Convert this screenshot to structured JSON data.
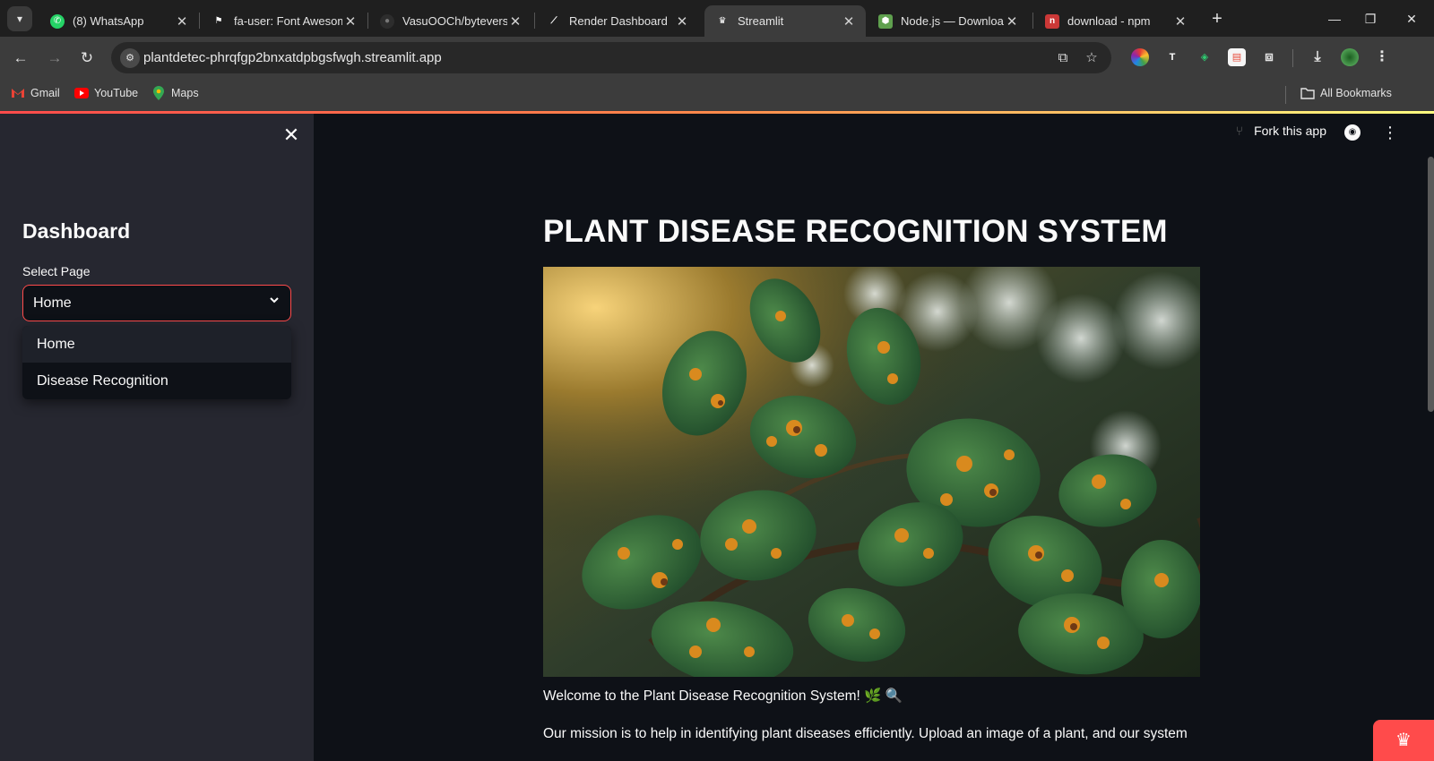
{
  "browser": {
    "tabs": [
      {
        "title": "(8) WhatsApp",
        "icon": "whatsapp-icon"
      },
      {
        "title": "fa-user: Font Awesom",
        "icon": "flag-icon"
      },
      {
        "title": "VasuOOCh/byteverse",
        "icon": "github-icon"
      },
      {
        "title": "Render Dashboard",
        "icon": "render-icon"
      },
      {
        "title": "Streamlit",
        "icon": "streamlit-icon"
      },
      {
        "title": "Node.js — Download",
        "icon": "nodejs-icon"
      },
      {
        "title": "download - npm",
        "icon": "npm-icon"
      }
    ],
    "active_tab": 4,
    "url": "plantdetec-phrqfgp2bnxatdpbgsfwgh.streamlit.app",
    "bookmarks": [
      "Gmail",
      "YouTube",
      "Maps"
    ],
    "all_bookmarks": "All Bookmarks"
  },
  "sidebar": {
    "title": "Dashboard",
    "select_label": "Select Page",
    "selected": "Home",
    "options": [
      "Home",
      "Disease Recognition"
    ]
  },
  "header": {
    "fork_label": "Fork this app"
  },
  "main": {
    "title": "PLANT DISEASE RECOGNITION SYSTEM",
    "welcome": "Welcome to the Plant Disease Recognition System! 🌿 🔍",
    "mission": "Our mission is to help in identifying plant diseases efficiently. Upload an image of a plant, and our system"
  },
  "colors": {
    "accent": "#ff4b4b",
    "sidebar_bg": "#262730",
    "main_bg": "#0e1117"
  }
}
